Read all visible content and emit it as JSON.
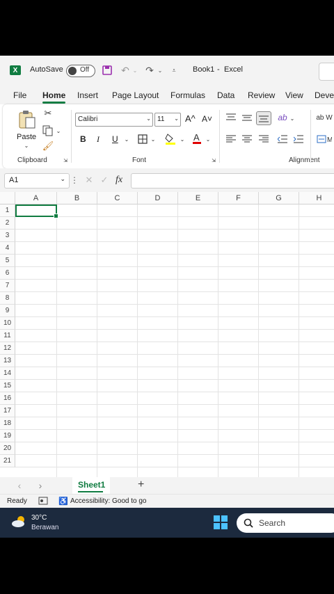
{
  "titlebar": {
    "autosave": "AutoSave",
    "toggle": "Off",
    "book": "Book1",
    "sep": "-",
    "app": "Excel"
  },
  "tabs": [
    "File",
    "Home",
    "Insert",
    "Page Layout",
    "Formulas",
    "Data",
    "Review",
    "View",
    "Devel"
  ],
  "ribbon": {
    "paste": "Paste",
    "font_name": "Calibri",
    "font_size": "11",
    "grow_font": "A^",
    "shrink_font": "A˅",
    "bold": "B",
    "italic": "I",
    "underline": "U",
    "groups": {
      "clipboard": "Clipboard",
      "font": "Font",
      "alignment": "Alignment"
    },
    "accent": "#107c41"
  },
  "formula_bar": {
    "cell_ref": "A1",
    "fx": "fx",
    "value": ""
  },
  "columns": [
    "A",
    "B",
    "C",
    "D",
    "E",
    "F",
    "G",
    "H"
  ],
  "rows": [
    "1",
    "2",
    "3",
    "4",
    "5",
    "6",
    "7",
    "8",
    "9",
    "10",
    "11",
    "12",
    "13",
    "14",
    "15",
    "16",
    "17",
    "18",
    "19",
    "20",
    "21"
  ],
  "sheets": {
    "active": "Sheet1",
    "add": "+"
  },
  "status": {
    "ready": "Ready",
    "accessibility": "Accessibility: Good to go"
  },
  "taskbar": {
    "temp": "30°C",
    "weather": "Berawan",
    "search": "Search"
  }
}
